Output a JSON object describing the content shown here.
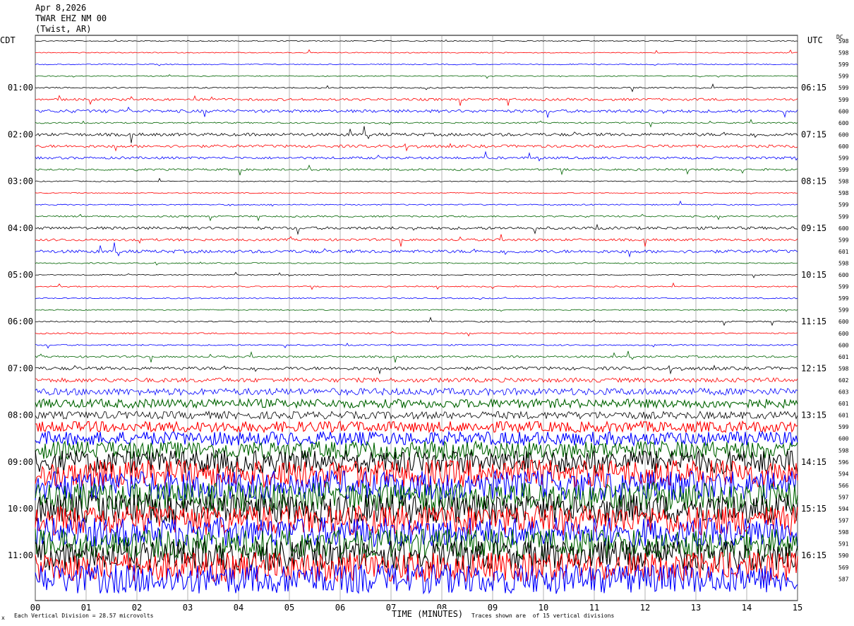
{
  "header": {
    "date": "Apr 8,2026",
    "station": "TWAR EHZ NM 00",
    "location": "(Twist, AR)"
  },
  "left_tz": "CDT",
  "right_tz": "UTC",
  "dc_label": "DC",
  "footer": {
    "scale_note": "Each Vertical Division = 28.57 microvolts",
    "xlabel": "TIME (MINUTES)",
    "trace_note": "Traces shown are  of 15 vertical divisions",
    "corner_mark": "x"
  },
  "colors": {
    "cycle": [
      "#000000",
      "#ff0000",
      "#0000ff",
      "#006400"
    ],
    "grid": "#808080"
  },
  "chart_data": {
    "type": "line",
    "title": "Apr 8,2026 TWAR EHZ NM 00 (Twist, AR)",
    "xlabel": "TIME (MINUTES)",
    "xlim": [
      0,
      15
    ],
    "x_ticks": [
      "00",
      "01",
      "02",
      "03",
      "04",
      "05",
      "06",
      "07",
      "08",
      "09",
      "10",
      "11",
      "12",
      "13",
      "14",
      "15"
    ],
    "row_minutes": 15,
    "left_hour_labels": [
      {
        "row": 4,
        "label": "01:00"
      },
      {
        "row": 8,
        "label": "02:00"
      },
      {
        "row": 12,
        "label": "03:00"
      },
      {
        "row": 16,
        "label": "04:00"
      },
      {
        "row": 20,
        "label": "05:00"
      },
      {
        "row": 24,
        "label": "06:00"
      },
      {
        "row": 28,
        "label": "07:00"
      },
      {
        "row": 32,
        "label": "08:00"
      },
      {
        "row": 36,
        "label": "09:00"
      },
      {
        "row": 40,
        "label": "10:00"
      },
      {
        "row": 44,
        "label": "11:00"
      }
    ],
    "right_hour_labels": [
      {
        "row": 4,
        "label": "06:15"
      },
      {
        "row": 8,
        "label": "07:15"
      },
      {
        "row": 12,
        "label": "08:15"
      },
      {
        "row": 16,
        "label": "09:15"
      },
      {
        "row": 20,
        "label": "10:15"
      },
      {
        "row": 24,
        "label": "11:15"
      },
      {
        "row": 28,
        "label": "12:15"
      },
      {
        "row": 32,
        "label": "13:15"
      },
      {
        "row": 36,
        "label": "14:15"
      },
      {
        "row": 40,
        "label": "15:15"
      },
      {
        "row": 44,
        "label": "16:15"
      }
    ],
    "dc_values": [
      598,
      598,
      599,
      599,
      599,
      599,
      600,
      600,
      600,
      600,
      599,
      599,
      598,
      598,
      599,
      599,
      600,
      599,
      601,
      598,
      600,
      599,
      599,
      599,
      600,
      600,
      600,
      601,
      598,
      602,
      603,
      601,
      601,
      599,
      600,
      598,
      596,
      594,
      566,
      597,
      594,
      597,
      598,
      591,
      590,
      569,
      587
    ],
    "row_activity": [
      0.5,
      0.5,
      0.5,
      0.5,
      0.7,
      1.2,
      1.5,
      0.7,
      1.5,
      1.4,
      1.2,
      1.0,
      0.5,
      0.5,
      0.6,
      0.8,
      1.4,
      1.2,
      1.6,
      0.6,
      0.5,
      0.6,
      0.6,
      0.6,
      0.7,
      0.7,
      0.7,
      1.0,
      1.6,
      2.2,
      3.5,
      4.5,
      3.8,
      5.5,
      7.0,
      9.0,
      12.0,
      14.0,
      15.0,
      15.0,
      15.0,
      15.0,
      15.0,
      15.0,
      15.0,
      15.0,
      15.0
    ]
  }
}
